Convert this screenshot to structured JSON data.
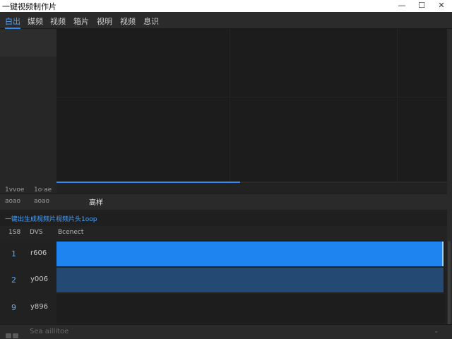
{
  "window": {
    "title": "一键视频制作片",
    "controls": {
      "minimize": "—",
      "maximize": "☐",
      "close": "✕"
    }
  },
  "menu": {
    "items": [
      {
        "label": "白出",
        "active": true
      },
      {
        "label": "媒频",
        "active": false
      },
      {
        "label": "视频",
        "active": false
      },
      {
        "label": "箱片",
        "active": false
      },
      {
        "label": "视明",
        "active": false
      },
      {
        "label": "视频",
        "active": false
      },
      {
        "label": "息识",
        "active": false
      }
    ]
  },
  "preview": {
    "progress": 0.47,
    "colors": {
      "accent": "#2d8cf0"
    }
  },
  "info": {
    "row1": [
      "1vvoe",
      "1o·ae"
    ],
    "row2": [
      "aoao",
      "aoao"
    ],
    "active_tab": "高样"
  },
  "section": {
    "title": "一键出生成视频片视频片头1oop"
  },
  "table": {
    "headers": [
      "1S8",
      "DVS",
      "Bcenect"
    ],
    "rows": [
      {
        "num": "1",
        "value": "r606",
        "level": 1.0,
        "color": "#1e84f0",
        "selected": true
      },
      {
        "num": "2",
        "value": "y006",
        "level": 1.0,
        "color": "#244a74",
        "selected": false
      },
      {
        "num": "9",
        "value": "y896",
        "level": 0.0,
        "color": "#1d1d1d",
        "selected": false
      }
    ]
  },
  "status": {
    "text": "Sea aillitoe",
    "icon": "folder-icon",
    "chevron": "⌄"
  }
}
